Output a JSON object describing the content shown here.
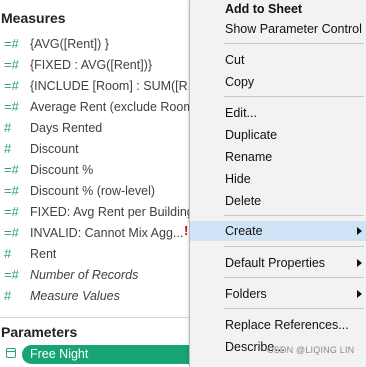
{
  "data_pane": {
    "measures_title": "Measures",
    "measures": [
      {
        "label": "{AVG([Rent]) }",
        "italic": false,
        "icon": "calc-measure-icon"
      },
      {
        "label": "{FIXED : AVG([Rent])}",
        "italic": false,
        "icon": "calc-measure-icon"
      },
      {
        "label": "{INCLUDE [Room] : SUM([R...",
        "italic": false,
        "icon": "calc-measure-icon"
      },
      {
        "label": "Average Rent (exclude Room",
        "italic": false,
        "icon": "calc-measure-icon"
      },
      {
        "label": "Days Rented",
        "italic": false,
        "icon": "measure-icon"
      },
      {
        "label": "Discount",
        "italic": false,
        "icon": "measure-icon"
      },
      {
        "label": "Discount %",
        "italic": false,
        "icon": "calc-measure-icon"
      },
      {
        "label": "Discount % (row-level)",
        "italic": false,
        "icon": "calc-measure-icon"
      },
      {
        "label": "FIXED: Avg Rent per Building",
        "italic": false,
        "icon": "calc-measure-icon"
      },
      {
        "label": "INVALID: Cannot Mix Agg...",
        "italic": false,
        "icon": "calc-measure-icon",
        "error": "!"
      },
      {
        "label": "Rent",
        "italic": false,
        "icon": "measure-icon"
      },
      {
        "label": "Number of Records",
        "italic": true,
        "icon": "measure-icon"
      },
      {
        "label": "Measure Values",
        "italic": true,
        "icon": "measure-icon"
      }
    ],
    "parameters_title": "Parameters",
    "parameter": {
      "label": "Free Night",
      "icon": "parameter-icon"
    }
  },
  "context_menu": {
    "items": [
      {
        "label": "Add to Sheet",
        "bold": true
      },
      {
        "label": "Show Parameter Control"
      },
      {
        "label": "Cut"
      },
      {
        "label": "Copy"
      },
      {
        "label": "Edit..."
      },
      {
        "label": "Duplicate"
      },
      {
        "label": "Rename"
      },
      {
        "label": "Hide"
      },
      {
        "label": "Delete"
      },
      {
        "label": "Create",
        "submenu": true,
        "highlighted": true
      },
      {
        "label": "Default Properties",
        "submenu": true
      },
      {
        "label": "Folders",
        "submenu": true
      },
      {
        "label": "Replace References..."
      },
      {
        "label": "Describe..."
      }
    ]
  },
  "watermark": "CSDN @LIQING LIN",
  "colors": {
    "accent_green": "#17a673",
    "menu_bg": "#f2f2f2",
    "highlight": "#cfe3f7",
    "error_red": "#d0021b"
  }
}
